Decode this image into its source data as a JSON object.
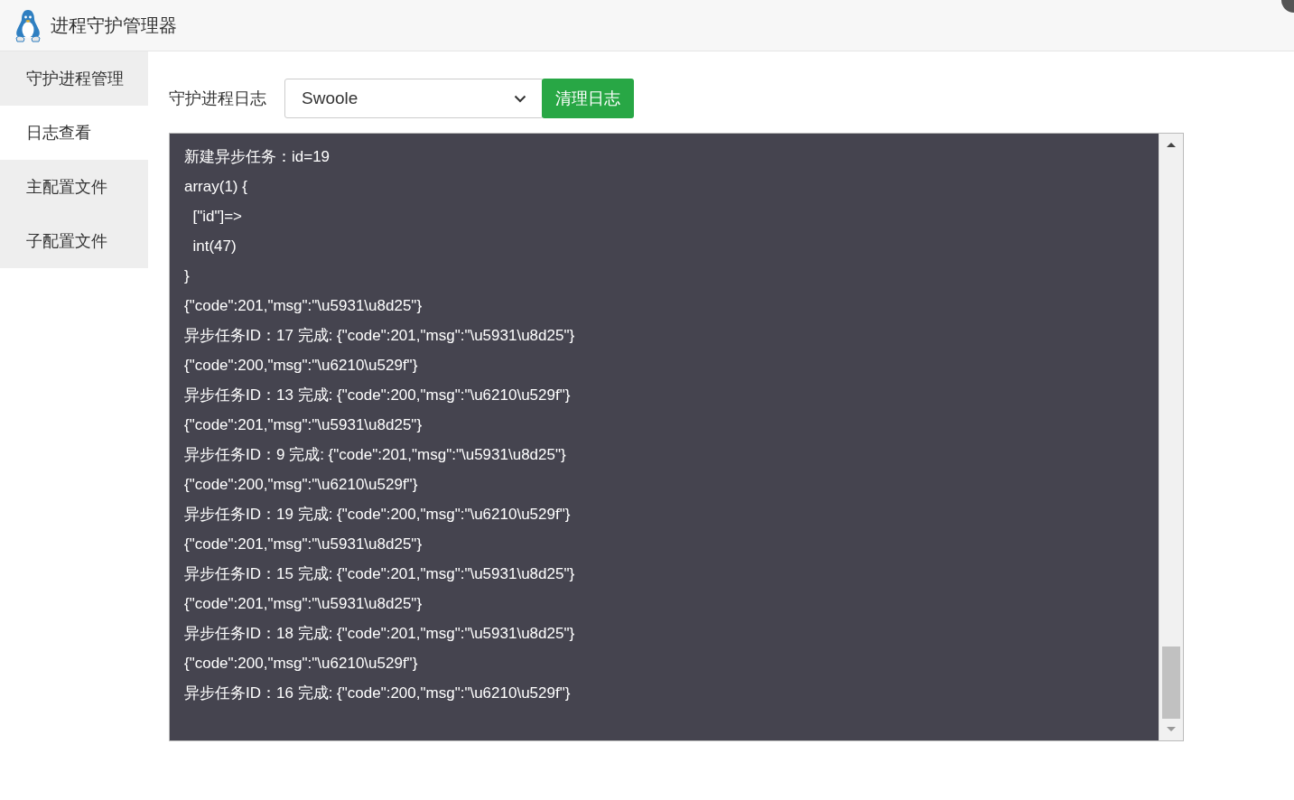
{
  "window": {
    "title": "进程守护管理器"
  },
  "sidebar": {
    "items": [
      {
        "label": "守护进程管理",
        "selected": false
      },
      {
        "label": "日志查看",
        "selected": true
      },
      {
        "label": "主配置文件",
        "selected": false
      },
      {
        "label": "子配置文件",
        "selected": false
      }
    ]
  },
  "toolbar": {
    "label": "守护进程日志",
    "select": {
      "value": "Swoole"
    },
    "button": "清理日志"
  },
  "log": {
    "lines": [
      "新建异步任务：id=19",
      "array(1) {",
      "  [\"id\"]=>",
      "  int(47)",
      "}",
      "{\"code\":201,\"msg\":\"\\u5931\\u8d25\"}",
      "异步任务ID：17 完成: {\"code\":201,\"msg\":\"\\u5931\\u8d25\"}",
      "{\"code\":200,\"msg\":\"\\u6210\\u529f\"}",
      "异步任务ID：13 完成: {\"code\":200,\"msg\":\"\\u6210\\u529f\"}",
      "{\"code\":201,\"msg\":\"\\u5931\\u8d25\"}",
      "异步任务ID：9 完成: {\"code\":201,\"msg\":\"\\u5931\\u8d25\"}",
      "{\"code\":200,\"msg\":\"\\u6210\\u529f\"}",
      "异步任务ID：19 完成: {\"code\":200,\"msg\":\"\\u6210\\u529f\"}",
      "{\"code\":201,\"msg\":\"\\u5931\\u8d25\"}",
      "异步任务ID：15 完成: {\"code\":201,\"msg\":\"\\u5931\\u8d25\"}",
      "{\"code\":201,\"msg\":\"\\u5931\\u8d25\"}",
      "异步任务ID：18 完成: {\"code\":201,\"msg\":\"\\u5931\\u8d25\"}",
      "{\"code\":200,\"msg\":\"\\u6210\\u529f\"}",
      "异步任务ID：16 完成: {\"code\":200,\"msg\":\"\\u6210\\u529f\"}"
    ]
  }
}
